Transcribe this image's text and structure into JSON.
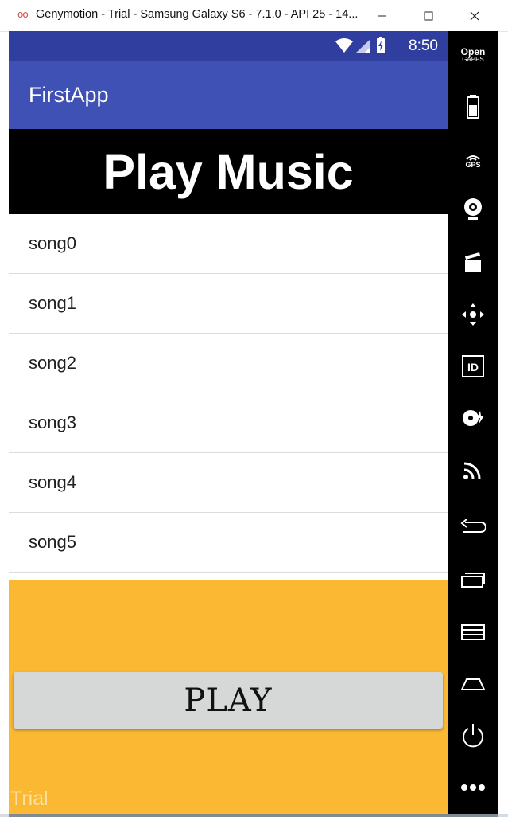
{
  "window": {
    "title": "Genymotion - Trial - Samsung Galaxy S6 - 7.1.0 - API 25 - 14..."
  },
  "status_bar": {
    "time": "8:50"
  },
  "app": {
    "title": "FirstApp",
    "header": "Play Music",
    "songs": [
      "song0",
      "song1",
      "song2",
      "song3",
      "song4",
      "song5"
    ],
    "play_label": "PLAY",
    "watermark": "Trial"
  },
  "toolbar": {
    "opengapps_line1": "Open",
    "opengapps_line2": "GAPPS",
    "gps_label": "GPS",
    "items": [
      "opengapps-icon",
      "battery-icon",
      "gps-icon",
      "webcam-icon",
      "capture-icon",
      "dpad-icon",
      "id-icon",
      "disk-icon",
      "cast-icon",
      "back-icon",
      "recent-apps-icon",
      "menu-icon",
      "home-icon",
      "power-icon",
      "more-icon"
    ]
  },
  "colors": {
    "status_bar": "#303f9f",
    "app_bar": "#3f51b5",
    "header_bg": "#000000",
    "bottom_panel": "#fbb833",
    "play_button": "#d6d7d7"
  }
}
